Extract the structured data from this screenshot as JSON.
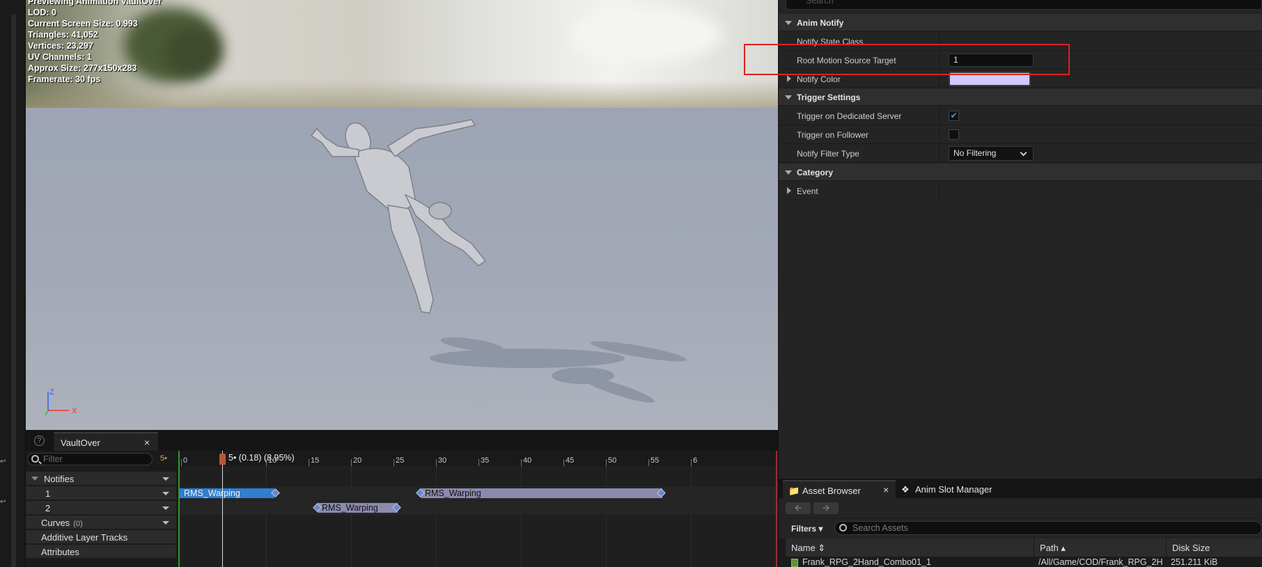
{
  "viewport": {
    "stats": [
      "Previewing Animation VaultOver",
      "LOD: 0",
      "Current Screen Size: 0.993",
      "Triangles: 41,052",
      "Vertices: 23,297",
      "UV Channels: 1",
      "Approx Size: 277x150x283",
      "Framerate: 30 fps"
    ],
    "axis_labels": {
      "z": "Z",
      "x": "X"
    }
  },
  "timeline": {
    "tab_label": "VaultOver",
    "tab_close": "×",
    "help_icon": "?",
    "filter_placeholder": "Filter",
    "frame_indicator": "5•",
    "playhead_label": "5• (0.18) (8.95%)",
    "ruler_ticks": [
      "0",
      "5",
      "10",
      "15",
      "20",
      "25",
      "30",
      "35",
      "40",
      "45",
      "50",
      "55",
      "6"
    ],
    "tracks": {
      "notifies": "Notifies",
      "track1": "1",
      "track2": "2",
      "curves": "Curves",
      "curves_count": "(0)",
      "additive": "Additive Layer Tracks",
      "attributes": "Attributes"
    },
    "notifies": [
      {
        "track": 1,
        "label": "RMS_Warping",
        "selected": true
      },
      {
        "track": 1,
        "label": "RMS_Warping",
        "selected": false
      },
      {
        "track": 2,
        "label": "RMS_Warping",
        "selected": false
      }
    ]
  },
  "details": {
    "search_placeholder": "Search",
    "sections": {
      "anim_notify": "Anim Notify",
      "trigger_settings": "Trigger Settings",
      "category": "Category"
    },
    "props": {
      "notify_state_class": "Notify State Class",
      "root_motion_label": "Root Motion Source Target",
      "root_motion_value": "1",
      "notify_color": "Notify Color",
      "notify_color_value": "#cfcaff",
      "trigger_dedicated": "Trigger on Dedicated Server",
      "trigger_dedicated_checked": true,
      "trigger_follower": "Trigger on Follower",
      "trigger_follower_checked": false,
      "filter_type": "Notify Filter Type",
      "filter_type_value": "No Filtering",
      "event": "Event"
    }
  },
  "asset_browser": {
    "tab_asset": "Asset Browser",
    "tab_close": "×",
    "tab_slot": "Anim Slot Manager",
    "filters": "Filters",
    "search_placeholder": "Search Assets",
    "columns": {
      "name": "Name",
      "path": "Path",
      "size": "Disk Size"
    },
    "rows": [
      {
        "name": "Frank_RPG_2Hand_Combo01_1",
        "path": "/All/Game/COD/Frank_RPG_2H",
        "size": "251.211 KiB"
      }
    ]
  },
  "colors": {
    "selected_notify": "#2f7fcf",
    "notify": "#8b8aae",
    "highlight": "#e02020",
    "playhead": "#b9563a"
  }
}
